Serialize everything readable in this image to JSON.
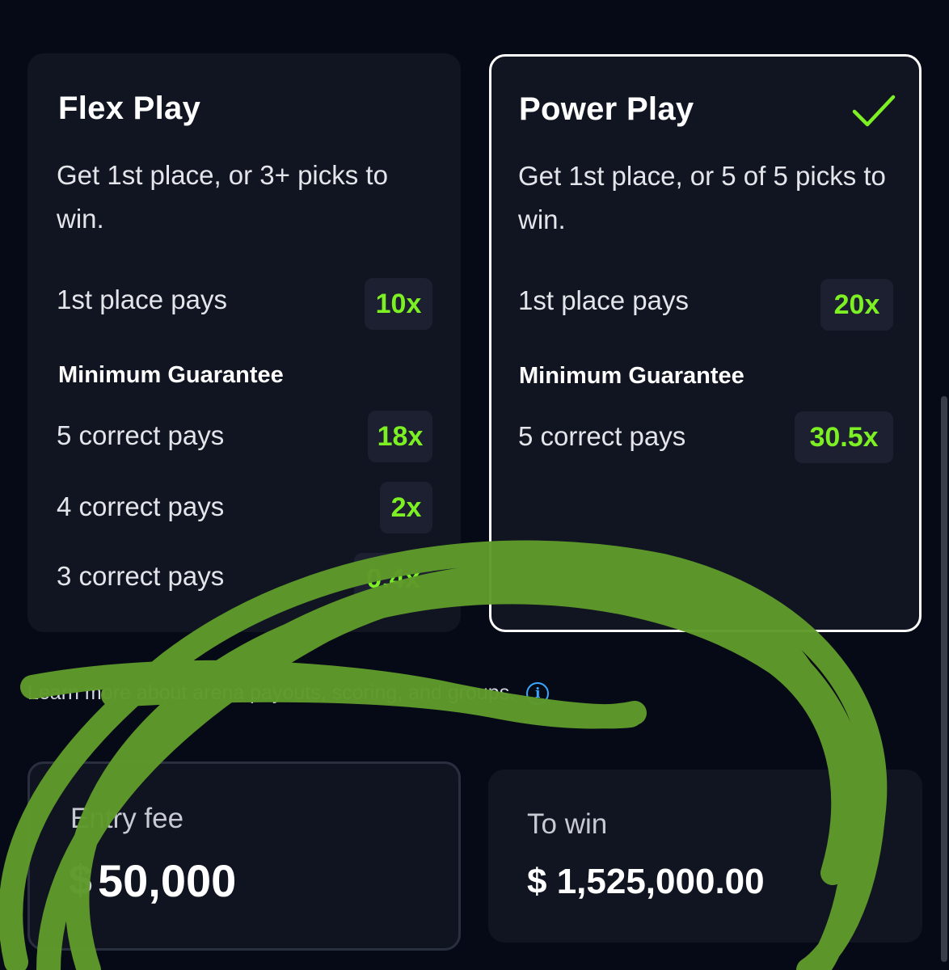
{
  "flex": {
    "title": "Flex Play",
    "description": "Get 1st place, or 3+ picks to win.",
    "first_place_label": "1st place pays",
    "first_place_value": "10x",
    "min_guarantee_label": "Minimum Guarantee",
    "rows": [
      {
        "label": "5 correct pays",
        "value": "18x"
      },
      {
        "label": "4 correct pays",
        "value": "2x"
      },
      {
        "label": "3 correct pays",
        "value": "0.4x"
      }
    ]
  },
  "power": {
    "title": "Power Play",
    "selected": true,
    "description": "Get 1st place, or 5 of 5 picks to win.",
    "first_place_label": "1st place pays",
    "first_place_value": "20x",
    "min_guarantee_label": "Minimum Guarantee",
    "rows": [
      {
        "label": "5 correct pays",
        "value": "30.5x"
      }
    ]
  },
  "info": {
    "text": "Learn more about arena payouts, scoring, and groups.",
    "icon": "info-icon"
  },
  "entry": {
    "label": "Entry fee",
    "currency": "$",
    "value": "50,000"
  },
  "win": {
    "label": "To win",
    "value": "$ 1,525,000.00"
  },
  "colors": {
    "background": "#060a17",
    "card": "#111521",
    "accent_green": "#7cf023",
    "info_blue": "#3aa8ff",
    "scribble": "#5f9a2a"
  }
}
